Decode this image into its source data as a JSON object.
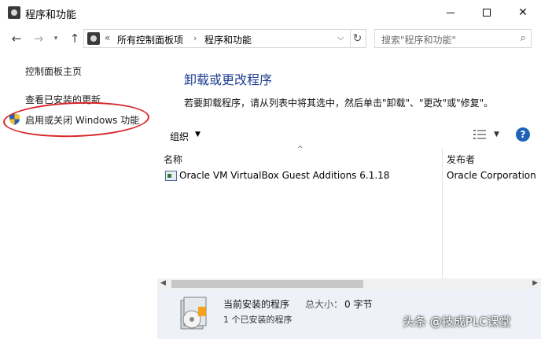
{
  "window": {
    "title": "程序和功能",
    "minimize": "",
    "maximize": "",
    "close": "✕"
  },
  "nav": {
    "back": "←",
    "forward": "→",
    "up": "↑",
    "address_chevron": "«",
    "address_part1": "所有控制面板项",
    "address_separator": "›",
    "address_part2": "程序和功能",
    "address_dropdown": "⌵",
    "refresh": "↻",
    "search_placeholder": "搜索\"程序和功能\"",
    "search_icon": "⌕"
  },
  "sidebar": {
    "home": "控制面板主页",
    "updates": "查看已安装的更新",
    "features": "启用或关闭 Windows 功能"
  },
  "main": {
    "title": "卸载或更改程序",
    "description": "若要卸载程序，请从列表中将其选中，然后单击\"卸载\"、\"更改\"或\"修复\"。",
    "organize": "组织",
    "organize_arrow": "▼",
    "view_arrow": "▼",
    "help": "?",
    "sort_arrow": "^",
    "columns": {
      "name": "名称",
      "publisher": "发布者"
    },
    "programs": [
      {
        "name": "Oracle VM VirtualBox Guest Additions 6.1.18",
        "publisher": "Oracle Corporation"
      }
    ],
    "scroll_left": "◀",
    "scroll_right": "▶"
  },
  "details": {
    "title": "当前安装的程序",
    "size_label": "总大小：",
    "size_value": "0 字节",
    "count": "1 个已安装的程序"
  },
  "watermark": {
    "text": "头条 @技成PLC课堂"
  },
  "colors": {
    "title_blue": "#1e3f8f",
    "help_blue": "#1e63b8",
    "annotation_red": "#d9262a",
    "details_bg": "#eef2f8"
  }
}
